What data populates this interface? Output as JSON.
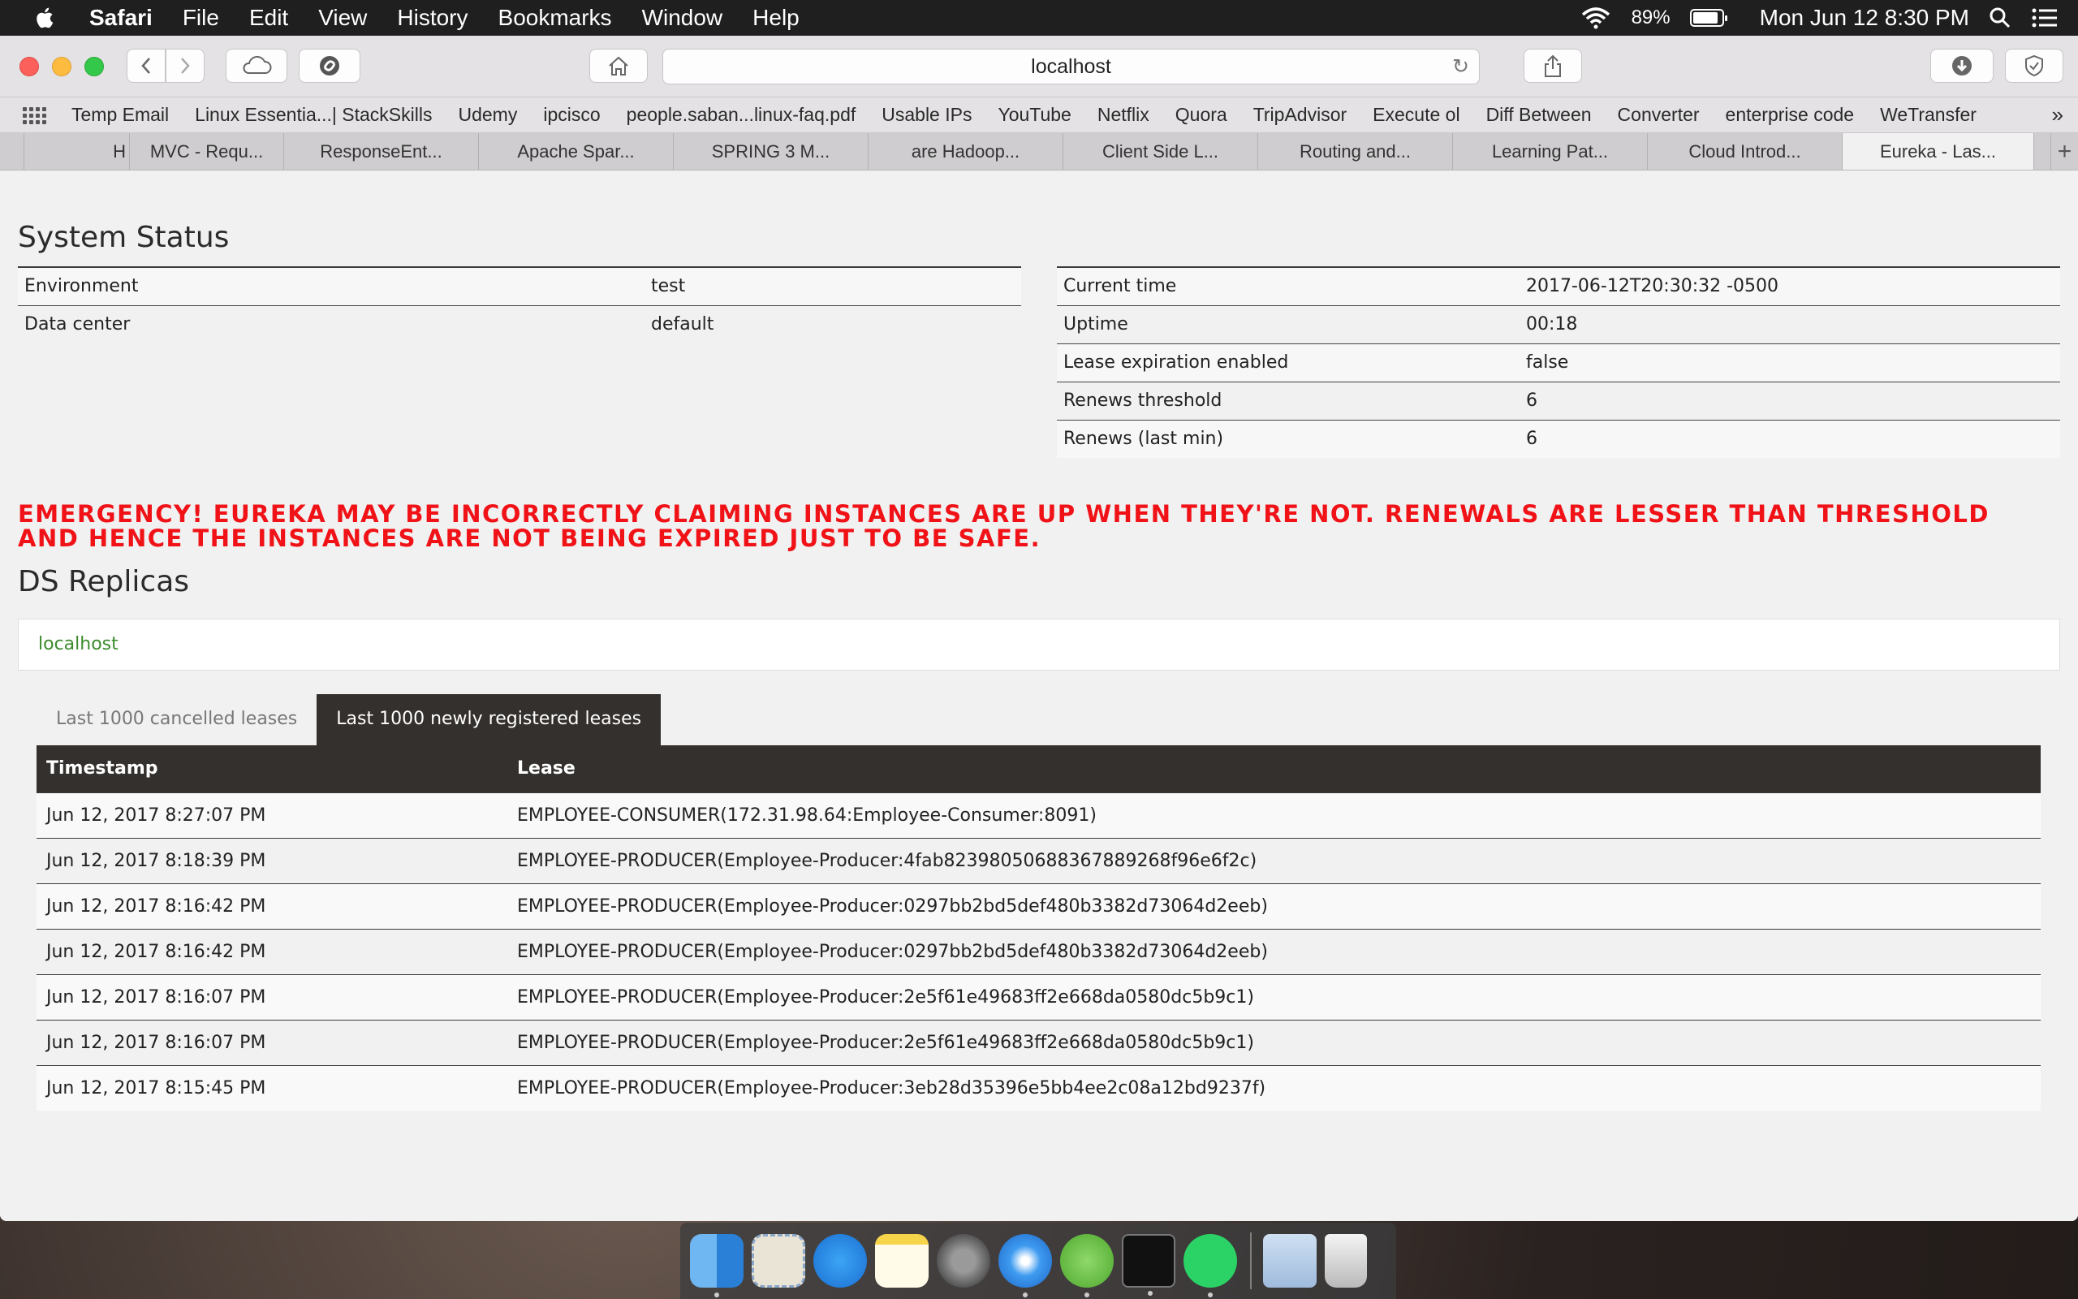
{
  "menubar": {
    "app_name": "Safari",
    "items": [
      "File",
      "Edit",
      "View",
      "History",
      "Bookmarks",
      "Window",
      "Help"
    ],
    "battery": "89%",
    "battery_level": 0.89,
    "clock": "Mon Jun 12  8:30 PM"
  },
  "browser": {
    "url": "localhost",
    "bookmarks": [
      "Temp Email",
      "Linux Essentia...| StackSkills",
      "Udemy",
      "ipcisco",
      "people.saban...linux-faq.pdf",
      "Usable IPs",
      "YouTube",
      "Netflix",
      "Quora",
      "TripAdvisor",
      "Execute ol",
      "Diff Between",
      "Converter",
      "enterprise code",
      "WeTransfer"
    ],
    "tabs": [
      "H",
      "MVC - Requ...",
      "ResponseEnt...",
      "Apache Spar...",
      "SPRING 3 M...",
      "are Hadoop...",
      "Client Side L...",
      "Routing and...",
      "Learning Pat...",
      "Cloud Introd...",
      "Eureka - Las..."
    ],
    "active_tab_index": 10
  },
  "system_status": {
    "title": "System Status",
    "left": [
      {
        "key": "Environment",
        "value": "test"
      },
      {
        "key": "Data center",
        "value": "default"
      }
    ],
    "right": [
      {
        "key": "Current time",
        "value": "2017-06-12T20:30:32 -0500"
      },
      {
        "key": "Uptime",
        "value": "00:18"
      },
      {
        "key": "Lease expiration enabled",
        "value": "false"
      },
      {
        "key": "Renews threshold",
        "value": "6"
      },
      {
        "key": "Renews (last min)",
        "value": "6"
      }
    ]
  },
  "emergency": "EMERGENCY! EUREKA MAY BE INCORRECTLY CLAIMING INSTANCES ARE UP WHEN THEY'RE NOT. RENEWALS ARE LESSER THAN THRESHOLD AND HENCE THE INSTANCES ARE NOT BEING EXPIRED JUST TO BE SAFE.",
  "replicas": {
    "title": "DS Replicas",
    "items": [
      "localhost"
    ]
  },
  "leases": {
    "tabs": [
      "Last 1000 cancelled leases",
      "Last 1000 newly registered leases"
    ],
    "active_tab": 1,
    "headers": [
      "Timestamp",
      "Lease"
    ],
    "rows": [
      [
        "Jun 12, 2017 8:27:07 PM",
        "EMPLOYEE-CONSUMER(172.31.98.64:Employee-Consumer:8091)"
      ],
      [
        "Jun 12, 2017 8:18:39 PM",
        "EMPLOYEE-PRODUCER(Employee-Producer:4fab823980506883678892​68f96e6f2c)"
      ],
      [
        "Jun 12, 2017 8:16:42 PM",
        "EMPLOYEE-PRODUCER(Employee-Producer:0297bb2bd5def480b3382d73064d2eeb)"
      ],
      [
        "Jun 12, 2017 8:16:42 PM",
        "EMPLOYEE-PRODUCER(Employee-Producer:0297bb2bd5def480b3382d73064d2eeb)"
      ],
      [
        "Jun 12, 2017 8:16:07 PM",
        "EMPLOYEE-PRODUCER(Employee-Producer:2e5f61e49683ff2e668da0580dc5b9c1)"
      ],
      [
        "Jun 12, 2017 8:16:07 PM",
        "EMPLOYEE-PRODUCER(Employee-Producer:2e5f61e49683ff2e668da0580dc5b9c1)"
      ],
      [
        "Jun 12, 2017 8:15:45 PM",
        "EMPLOYEE-PRODUCER(Employee-Producer:3eb28d35396e5bb4ee2c08a12bd9237f)"
      ]
    ]
  },
  "dock": [
    "finder-icon",
    "mail-icon",
    "app-store-icon",
    "notes-icon",
    "system-preferences-icon",
    "safari-icon",
    "spring-tool-suite-icon",
    "terminal-icon",
    "whatsapp-icon",
    "downloads-folder-icon",
    "trash-icon"
  ]
}
